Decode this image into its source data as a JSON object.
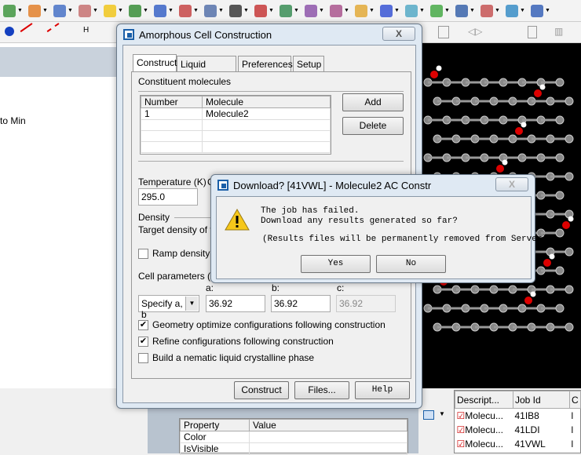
{
  "toolbar": {
    "icons": [
      "amorphous-icon",
      "orbital-icon",
      "bond-icon",
      "dftb-icon",
      "molecule-icon",
      "crystal-icon",
      "chain-icon",
      "peak-icon",
      "lattice-icon",
      "gaussian-icon",
      "target-icon",
      "kinetics-icon",
      "mesocite-icon",
      "polymer-icon",
      "color-icon",
      "diamond-icon",
      "swirl-icon",
      "reaction-icon",
      "play-icon",
      "spectrum-icon",
      "dna-icon",
      "grid-icon"
    ]
  },
  "left_pane": {
    "text": "to Min"
  },
  "ac_dialog": {
    "title": "Amorphous Cell Construction",
    "tabs": [
      "Construct",
      "Liquid Crystal",
      "Preferences",
      "Setup"
    ],
    "constituent_label": "Constituent molecules",
    "table": {
      "headers": [
        "Number",
        "Molecule"
      ],
      "rows": [
        [
          "1",
          "Molecule2"
        ]
      ]
    },
    "add": "Add",
    "delete": "Delete",
    "temperature_label": "Temperature (K)",
    "temperature": "295.0",
    "other_label_partial": "C",
    "density_label": "Density",
    "target_density": "Target density of th",
    "ramp": "Ramp density fr",
    "cell_label": "Cell parameters (An",
    "cell_mode": "Specify a, b",
    "a_label": "a:",
    "b_label": "b:",
    "c_label": "c:",
    "a": "36.92",
    "b": "36.92",
    "c": "36.92",
    "opt1": "Geometry optimize configurations following construction",
    "opt1_checked": true,
    "opt2": "Refine configurations following construction",
    "opt2_checked": true,
    "opt3": "Build a nematic liquid crystalline phase",
    "opt3_checked": false,
    "construct": "Construct",
    "files": "Files...",
    "help": "Help"
  },
  "download_dialog": {
    "title": "Download? [41VWL] - Molecule2 AC Constr",
    "line1": "The job has failed.",
    "line2": "Download any results generated so far?",
    "line3": "(Results files will be permanently removed from Server)",
    "yes": "Yes",
    "no": "No"
  },
  "properties": {
    "headers": [
      "Property",
      "Value"
    ],
    "rows": [
      "Color",
      "IsVisible"
    ]
  },
  "jobs": {
    "headers": [
      "Descript...",
      "Job Id",
      "C"
    ],
    "rows": [
      [
        "Molecu...",
        "41IB8",
        "l"
      ],
      [
        "Molecu...",
        "41LDI",
        "l"
      ],
      [
        "Molecu...",
        "41VWL",
        "l"
      ]
    ]
  },
  "checkmark": "✔"
}
